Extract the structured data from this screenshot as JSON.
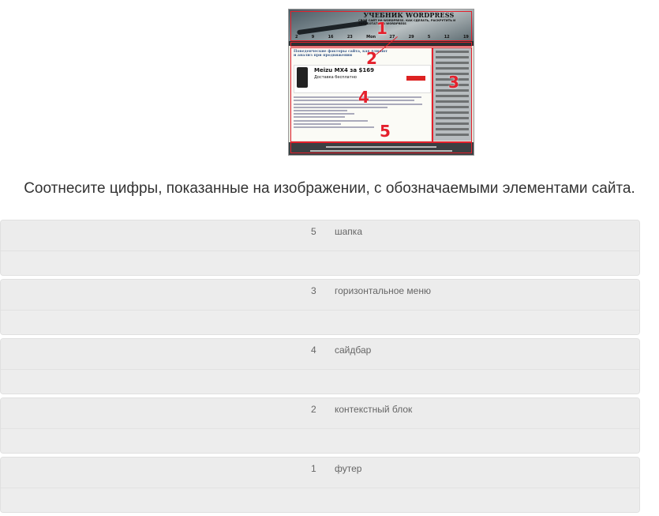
{
  "image": {
    "title": "УЧЕБНИК WORDPRESS",
    "subtitle": "СВОЙ САЙТ НА WORDPRESS. КАК СДЕЛАТЬ, РАСКРУТИТЬ И ЗАРАБОТАТЬ НА WORDPRESS",
    "clock": [
      "2",
      "9",
      "16",
      "23",
      "Mon",
      "27",
      "29",
      "5",
      "12",
      "19"
    ],
    "post_title": "Поведенческие факторы сайта, как влияют и анализ при продвижении",
    "ad_title": "Meizu MX4 за $169",
    "ad_subtitle": "Доставка бесплатно",
    "markers": [
      "1",
      "2",
      "3",
      "4",
      "5"
    ]
  },
  "question": "Соотнесите цифры, показанные на изображении, с обозначаемыми элементами сайта.",
  "pairs": [
    {
      "number": "5",
      "label": "шапка"
    },
    {
      "number": "3",
      "label": "горизонтальное меню"
    },
    {
      "number": "4",
      "label": "сайдбар"
    },
    {
      "number": "2",
      "label": "контекстный блок"
    },
    {
      "number": "1",
      "label": "футер"
    }
  ],
  "colors": {
    "marker": "#e4202c",
    "row_bg": "#ececec",
    "text": "#333333"
  }
}
